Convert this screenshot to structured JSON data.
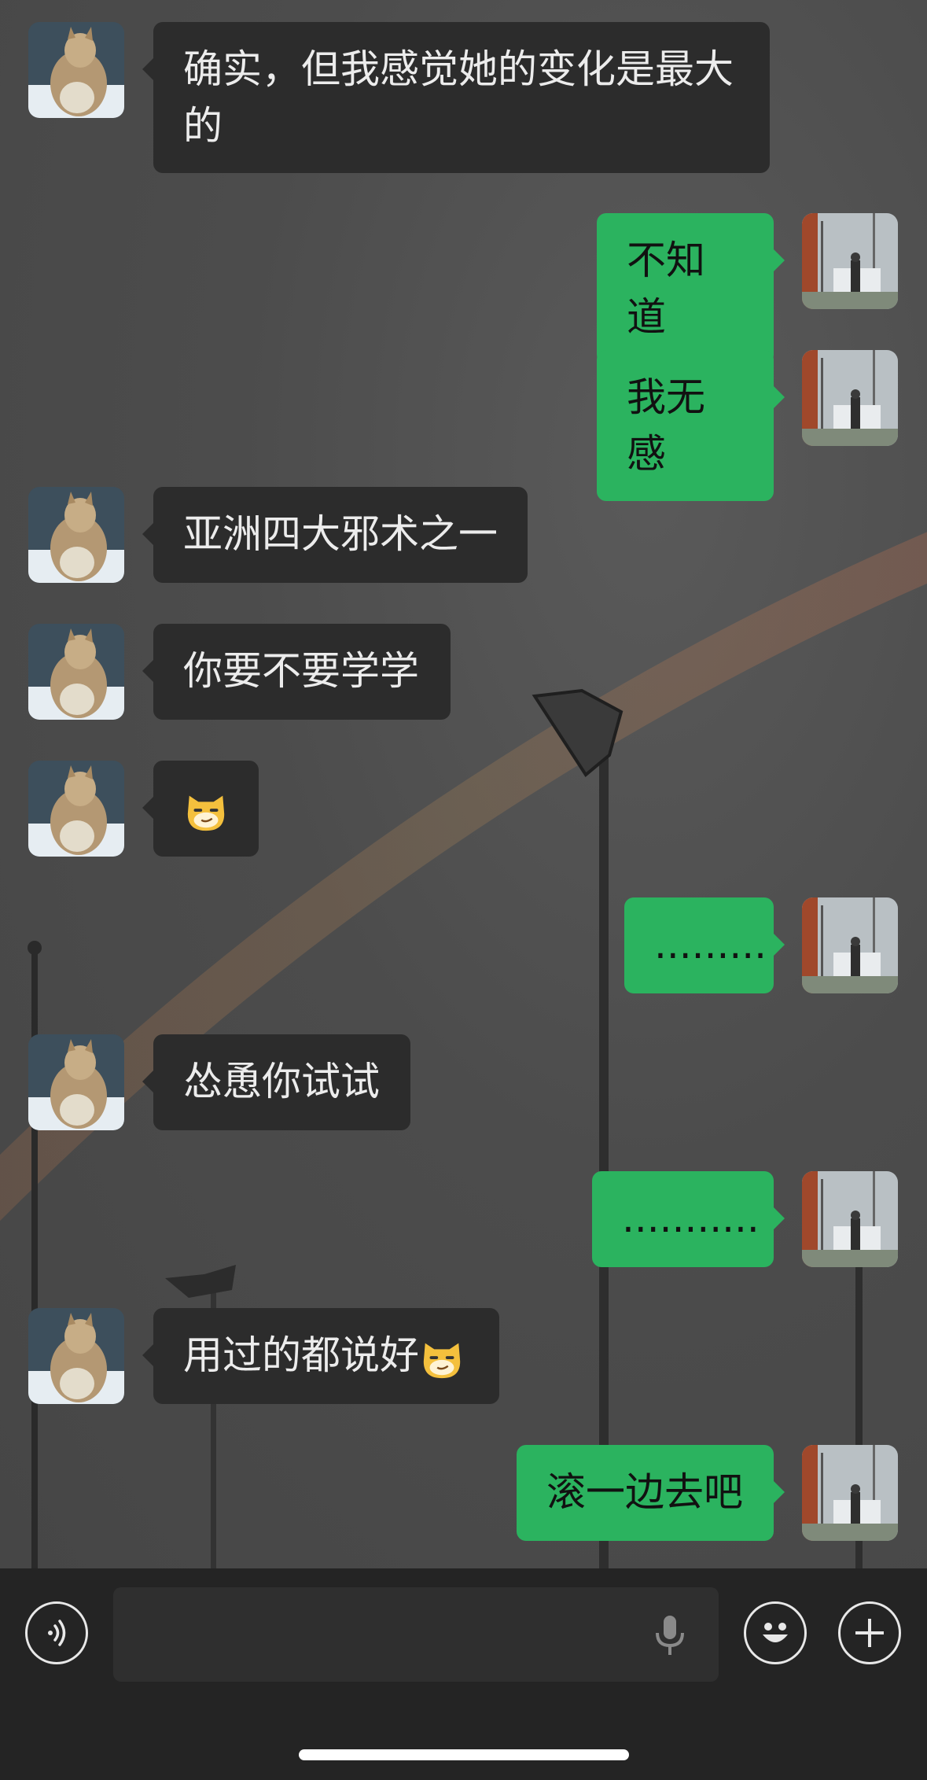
{
  "messages": [
    {
      "side": "in",
      "text": "确实，但我感觉她的变化是最大的"
    },
    {
      "side": "out",
      "text": "不知道"
    },
    {
      "side": "out",
      "text": "我无感"
    },
    {
      "side": "in",
      "text": "亚洲四大邪术之一"
    },
    {
      "side": "in",
      "text": "你要不要学学"
    },
    {
      "side": "in",
      "text": "",
      "emoji": "smirk-cat"
    },
    {
      "side": "out",
      "text": "........."
    },
    {
      "side": "in",
      "text": "怂恿你试试"
    },
    {
      "side": "out",
      "text": "..........."
    },
    {
      "side": "in",
      "text": "用过的都说好",
      "emoji": "smirk-cat"
    },
    {
      "side": "out",
      "text": "滚一边去吧"
    }
  ],
  "input_bar": {
    "voice_icon": "voice-icon",
    "mic_icon": "microphone-icon",
    "emoji_icon": "emoji-icon",
    "plus_icon": "plus-icon"
  },
  "colors": {
    "outgoing_bubble": "#2bb35f",
    "incoming_bubble": "#2c2c2c"
  }
}
